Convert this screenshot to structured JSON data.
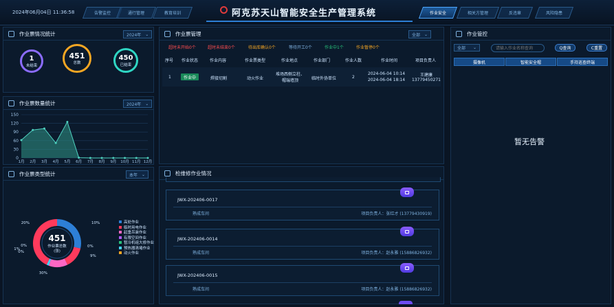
{
  "header": {
    "datetime": "2024年06月04日 11:36:58",
    "title": "阿克苏天山智能安全生产管理系统",
    "left_tabs": [
      "告警监控",
      "通行管理",
      "教育培训"
    ],
    "right_tabs": [
      "作业安全",
      "相关方管理",
      "反违章",
      "风险隐患"
    ],
    "active_tab": "作业安全"
  },
  "stats": {
    "title": "作业票情况统计",
    "year": "2024年",
    "rings": [
      {
        "value": "1",
        "label": "未结束",
        "color": "#8b6cff"
      },
      {
        "value": "451",
        "label": "总数",
        "color": "#f5a623"
      },
      {
        "value": "450",
        "label": "已结束",
        "color": "#2fd6c3"
      }
    ]
  },
  "count_chart": {
    "title": "作业票数量统计",
    "year": "2024年",
    "chart_data": {
      "type": "area",
      "categories": [
        "1月",
        "2月",
        "3月",
        "4月",
        "5月",
        "6月",
        "7月",
        "8月",
        "9月",
        "10月",
        "11月",
        "12月"
      ],
      "values": [
        62,
        97,
        102,
        52,
        125,
        1,
        0,
        0,
        0,
        0,
        0,
        0
      ],
      "ylim": [
        0,
        150
      ],
      "yticks": [
        "150",
        "120",
        "90",
        "60",
        "30",
        "0"
      ],
      "color": "#2d8a7e"
    }
  },
  "type_chart": {
    "title": "作业票类型统计",
    "select": "本年",
    "total": "451",
    "center_label": "作业票总数",
    "center_unit": "(张)",
    "chart_data": {
      "type": "pie",
      "values": [
        20,
        10,
        0,
        0,
        9,
        0,
        1,
        30
      ],
      "labels": [
        "20%",
        "10%",
        "0%",
        "0%",
        "9%",
        "0%",
        "1%",
        "30%"
      ],
      "colors": [
        "#2d7fd6",
        "#ff3a5c",
        "#b15cff",
        "#3a6cff",
        "#ff67c4",
        "#27c27a",
        "#45d6ff",
        "#ff3a5c"
      ]
    },
    "legend": [
      {
        "name": "高处作业",
        "color": "#2d7fd6"
      },
      {
        "name": "临时用电作业",
        "color": "#ff3a5c"
      },
      {
        "name": "起重吊装作业",
        "color": "#ff67c4"
      },
      {
        "name": "有限空间作业",
        "color": "#b15cff"
      },
      {
        "name": "暂冷机组大修作业",
        "color": "#27c27a"
      },
      {
        "name": "预热器清堵作业",
        "color": "#45d6ff"
      },
      {
        "name": "动火作业",
        "color": "#f5a623"
      }
    ]
  },
  "work": {
    "title": "作业票管理",
    "select": "全部",
    "filters": [
      {
        "text": "超时未开始0个",
        "color": "#ff4d4f"
      },
      {
        "text": "超时未结束0个",
        "color": "#ff4d4f"
      },
      {
        "text": "待出库确认0个",
        "color": "#f5a623"
      },
      {
        "text": "等待开工0个",
        "color": "#7fb2e0"
      },
      {
        "text": "作业中1个",
        "color": "#27c27a"
      },
      {
        "text": "作业暂停0个",
        "color": "#f5a623"
      }
    ],
    "columns": [
      "序号",
      "作业状态",
      "作业内容",
      "作业票类型",
      "作业地点",
      "作业部门",
      "作业人数",
      "作业时间",
      "项目负责人"
    ],
    "rows": [
      {
        "no": "1",
        "status": "作业中",
        "content": "焊接切割",
        "type": "动火作业",
        "place1": "堆场西侧立柱、",
        "place2": "帽瑞墙顶",
        "dept": "临时外协单位",
        "count": "2",
        "time1": "2024-06-04 10:14",
        "time2": "2024-06-04 18:14",
        "leader1": "王建康",
        "leader2": "13779450271"
      }
    ]
  },
  "inspection": {
    "title": "检维修作业情况",
    "cards": [
      {
        "code": "JWX-202406-0017",
        "sub": "熟成车间",
        "leader": "项目负责人：张红才 (13779430919)"
      },
      {
        "code": "JWX-202406-0014",
        "sub": "熟成车间",
        "leader": "项目负责人：赵永雅 (15886826932)"
      },
      {
        "code": "JWX-202406-0015",
        "sub": "熟成车间",
        "leader": "项目负责人：赵永雅 (15886826932)"
      }
    ]
  },
  "control": {
    "title": "作业管控",
    "select": "全部",
    "search_placeholder": "请输入作业名称查询",
    "query": "Q查询",
    "reset": "C重置",
    "buttons": [
      "摄像机",
      "智能安全帽",
      "手持巡查终端"
    ],
    "empty": "暂无告警"
  }
}
